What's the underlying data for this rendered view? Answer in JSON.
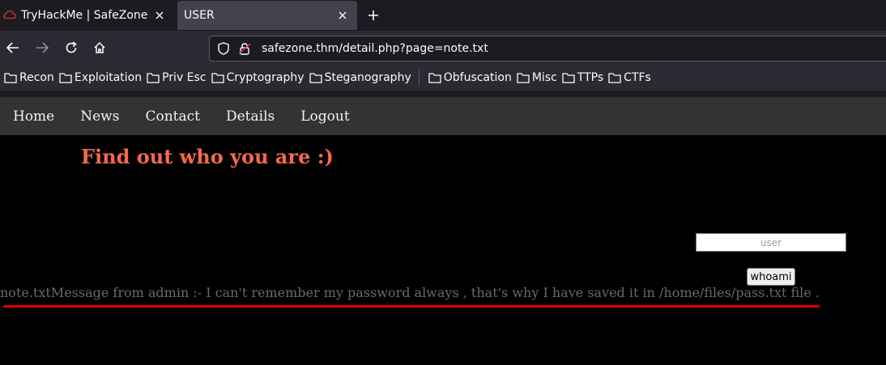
{
  "browser": {
    "tabs": [
      {
        "title": "TryHackMe | SafeZone",
        "favicon": "thm-cloud-icon",
        "active": false
      },
      {
        "title": "USER",
        "active": true
      }
    ],
    "url": "safezone.thm/detail.php?page=note.txt",
    "bookmarks": [
      "Recon",
      "Exploitation",
      "Priv Esc",
      "Cryptography",
      "Steganography",
      "Obfuscation",
      "Misc",
      "TTPs",
      "CTFs"
    ]
  },
  "page": {
    "nav": [
      "Home",
      "News",
      "Contact",
      "Details",
      "Logout"
    ],
    "heading": "Find out who you are :)",
    "input_placeholder": "user",
    "button_label": "whoami",
    "message": "note.txtMessage from admin :- I can't remember my password always , that's why I have saved it in /home/files/pass.txt file ."
  },
  "colors": {
    "heading": "#f5694b",
    "annotation_underline": "#e00000",
    "page_nav_bg": "#333333"
  }
}
